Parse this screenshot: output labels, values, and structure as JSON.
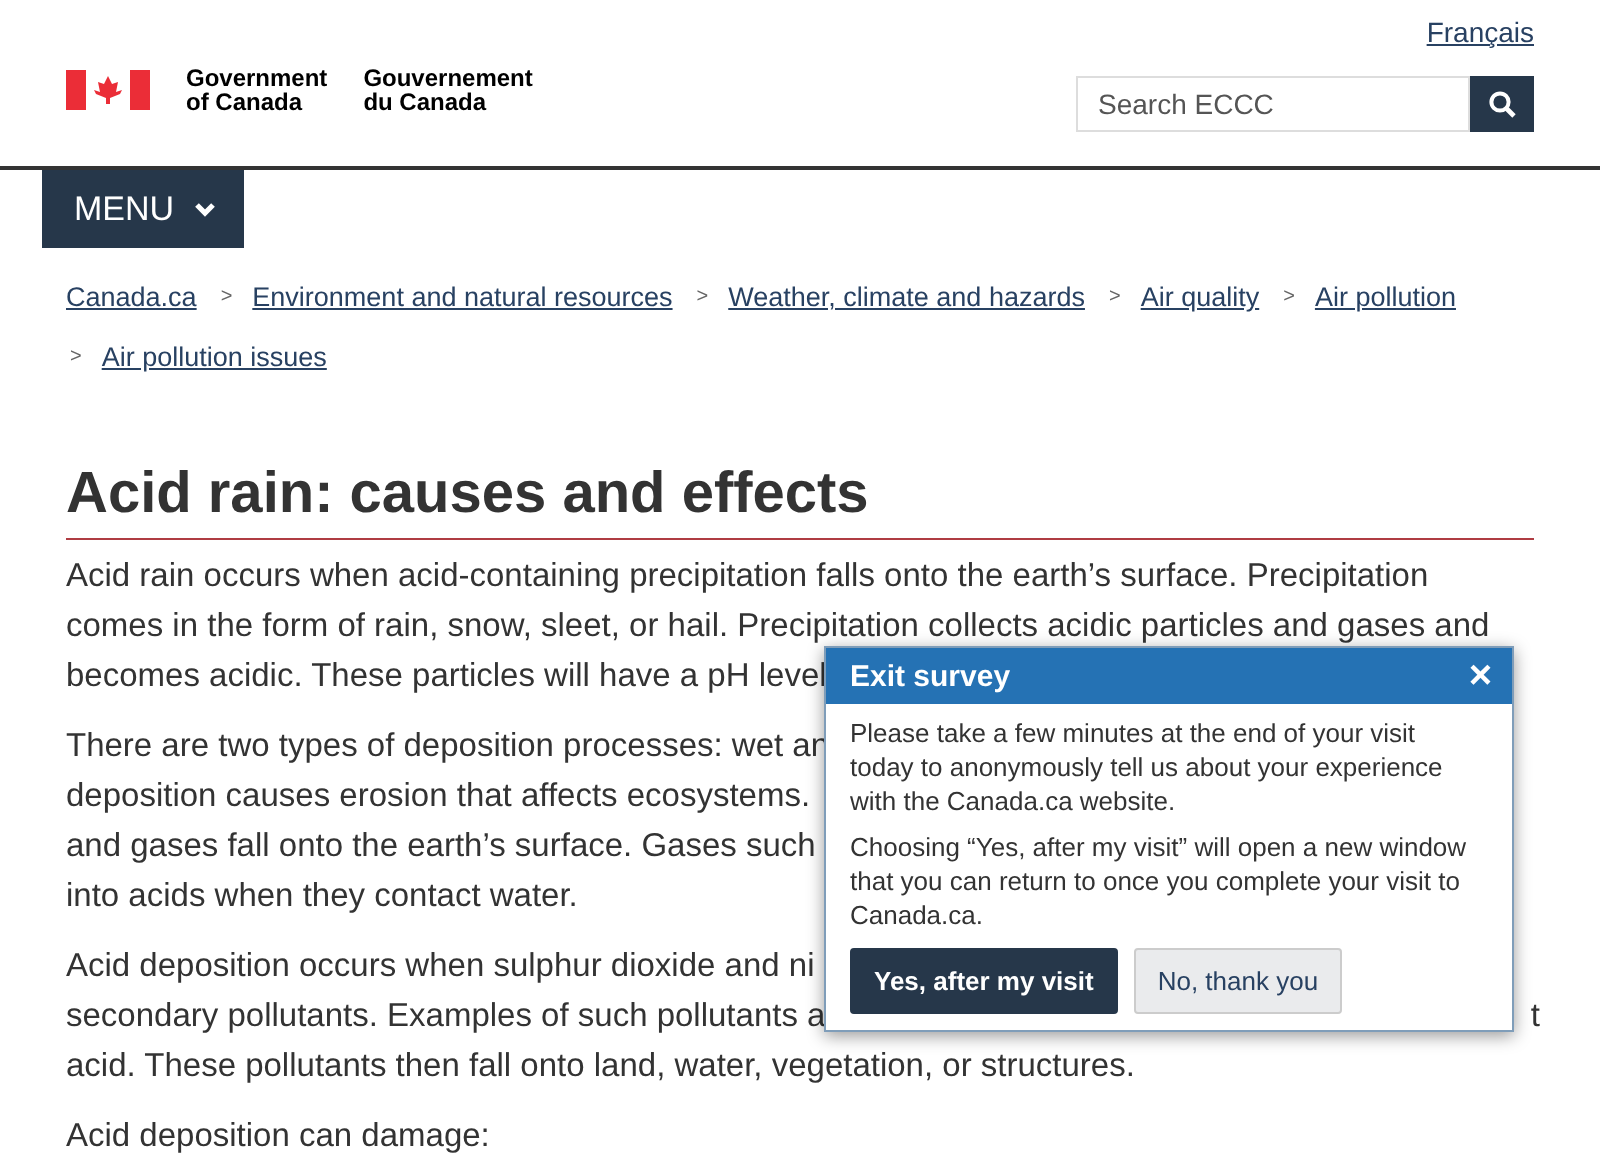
{
  "header": {
    "language_link": "Français",
    "signature": {
      "english": [
        "Government",
        "of Canada"
      ],
      "french": [
        "Gouvernement",
        "du Canada"
      ]
    },
    "search": {
      "placeholder": "Search ECCC"
    }
  },
  "menu": {
    "label": "MENU"
  },
  "breadcrumbs": [
    {
      "label": "Canada.ca"
    },
    {
      "separator": ">",
      "label": "Environment and natural resources"
    },
    {
      "separator": ">",
      "label": "Weather, climate and hazards"
    },
    {
      "separator": ">",
      "label": "Air quality"
    },
    {
      "separator": ">",
      "label": "Air pollution"
    },
    {
      "separator": ">",
      "label": "Air pollution issues"
    }
  ],
  "title": "Acid rain: causes and effects",
  "paragraphs": [
    {
      "lines": [
        {
          "left": "Acid rain occurs when acid-containing precipitation falls onto the earth’s surface. Precipitation"
        },
        {
          "left": "comes in the form of rain, snow, sleet, or hail. Precipitation collects acidic particles and gases and"
        },
        {
          "left": "becomes acidic. These particles will have a pH level"
        }
      ]
    },
    {
      "lines": [
        {
          "left": "There are two types of deposition processes: wet an"
        },
        {
          "left": "deposition causes erosion that affects ecosystems."
        },
        {
          "left": "and gases fall onto the earth’s surface. Gases such"
        },
        {
          "left": "into acids when they contact water."
        }
      ]
    },
    {
      "lines": [
        {
          "left": "Acid deposition occurs when sulphur dioxide and ni"
        },
        {
          "left": "secondary pollutants. Examples of such pollutants a",
          "right": "t"
        },
        {
          "left": "acid. These pollutants then fall onto land, water, vegetation, or structures."
        }
      ]
    },
    {
      "lines": [
        {
          "left": "Acid deposition can damage:"
        }
      ]
    }
  ],
  "survey": {
    "title": "Exit survey",
    "close": "×",
    "paragraphs": [
      "Please take a few minutes at the end of your visit today to anonymously tell us about your experience with the Canada.ca website.",
      "Choosing “Yes, after my visit” will open a new window that you can return to once you complete your visit to Canada.ca."
    ],
    "buttons": [
      {
        "label": "Yes, after my visit",
        "kind": "primary"
      },
      {
        "label": "No, thank you",
        "kind": "secondary"
      }
    ]
  }
}
